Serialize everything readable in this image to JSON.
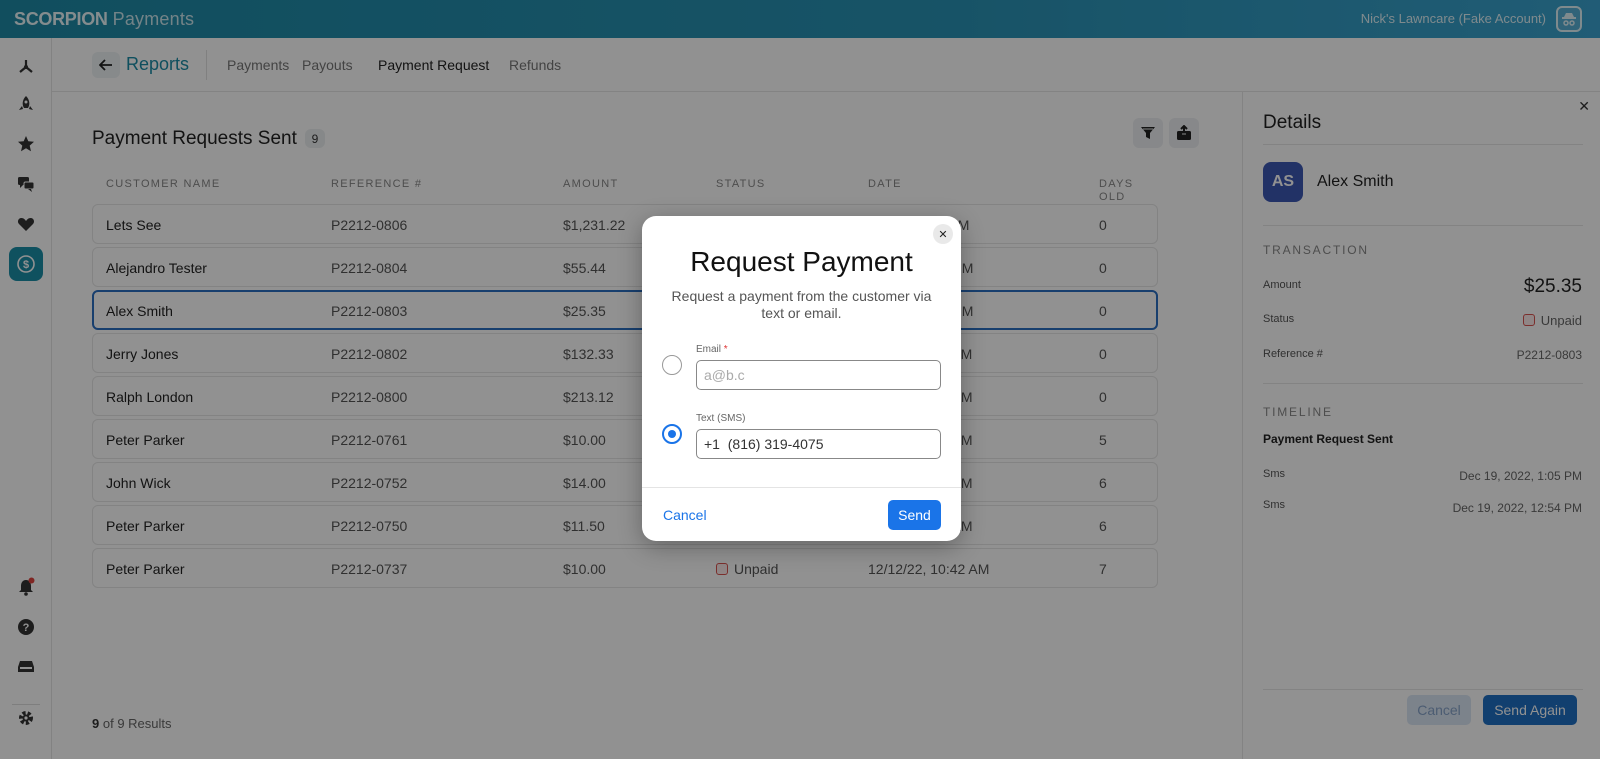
{
  "topbar": {
    "brand_bold": "SCORPION",
    "brand_light": "Payments",
    "account": "Nick's Lawncare (Fake Account)"
  },
  "nav": {
    "back_label": "←",
    "section": "Reports",
    "tabs": [
      "Payments",
      "Payouts",
      "Payment Request",
      "Refunds"
    ],
    "active_tab": "Payment Request"
  },
  "list": {
    "title": "Payment Requests Sent",
    "count": "9",
    "columns": [
      "CUSTOMER NAME",
      "REFERENCE #",
      "AMOUNT",
      "STATUS",
      "DATE",
      "DAYS",
      "OLD"
    ],
    "rows": [
      {
        "name": "Lets See",
        "ref": "P2212-0806",
        "amount": "$1,231.22",
        "date": "00 PM",
        "days": "0"
      },
      {
        "name": "Alejandro Tester",
        "ref": "P2212-0804",
        "amount": "$55.44",
        "date": ":56 PM",
        "days": "0"
      },
      {
        "name": "Alex Smith",
        "ref": "P2212-0803",
        "amount": "$25.35",
        "date": ":54 PM",
        "days": "0"
      },
      {
        "name": "Jerry Jones",
        "ref": "P2212-0802",
        "amount": "$132.33",
        "date": ":11 PM",
        "days": "0"
      },
      {
        "name": "Ralph London",
        "ref": "P2212-0800",
        "amount": "$213.12",
        "date": ":17 AM",
        "days": "0"
      },
      {
        "name": "Peter Parker",
        "ref": "P2212-0761",
        "amount": "$10.00",
        "date": ":30 AM",
        "days": "5"
      },
      {
        "name": "John Wick",
        "ref": "P2212-0752",
        "amount": "$14.00",
        "date": ":56 AM",
        "days": "6"
      },
      {
        "name": "Peter Parker",
        "ref": "P2212-0750",
        "amount": "$11.50",
        "date": ":49 AM",
        "days": "6"
      },
      {
        "name": "Peter Parker",
        "ref": "P2212-0737",
        "amount": "$10.00",
        "status": "Unpaid",
        "date": "12/12/22, 10:42 AM",
        "days": "7"
      }
    ],
    "results_count": "9",
    "results_suffix": "of 9 Results"
  },
  "details": {
    "title": "Details",
    "initials": "AS",
    "name": "Alex Smith",
    "transaction_heading": "TRANSACTION",
    "amount_label": "Amount",
    "amount": "$25.35",
    "status_label": "Status",
    "status": "Unpaid",
    "ref_label": "Reference #",
    "ref": "P2212-0803",
    "timeline_heading": "TIMELINE",
    "timeline_title": "Payment Request Sent",
    "timeline": [
      {
        "type": "Sms",
        "date": "Dec 19, 2022, 1:05 PM"
      },
      {
        "type": "Sms",
        "date": "Dec 19, 2022, 12:54 PM"
      }
    ],
    "cancel_label": "Cancel",
    "send_again_label": "Send Again"
  },
  "modal": {
    "title": "Request Payment",
    "description": "Request a payment from the customer via text or email.",
    "email_label": "Email",
    "email_placeholder": "a@b.c",
    "sms_label": "Text (SMS)",
    "sms_value": "+1  (816) 319-4075",
    "cancel_label": "Cancel",
    "send_label": "Send"
  },
  "colors": {
    "accent": "#1c8fa8",
    "primary_button": "#1a74e8",
    "unpaid": "#d9534f",
    "avatar": "#3d58b4"
  }
}
